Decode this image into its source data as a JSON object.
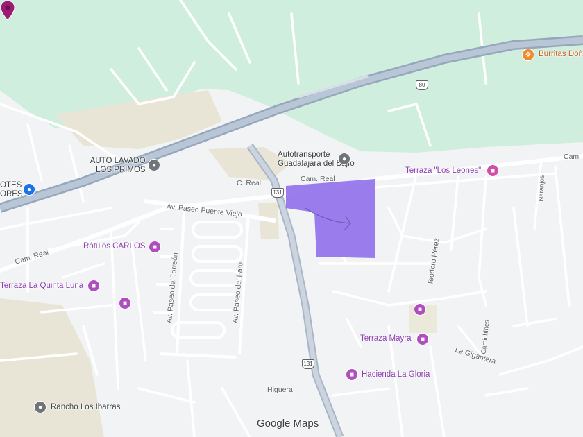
{
  "colors": {
    "park": "#cfeedd",
    "land": "#f1f3f4",
    "urban": "#e8e6dc",
    "road": "#ffffff",
    "highway": "#aab8c9",
    "highlight": "#8e6bec",
    "poi_purple": "#b04ec0",
    "poi_gray": "#70757a",
    "poi_orange": "#f08a2d",
    "marker": "#9c1b75"
  },
  "labels": {
    "burritas": "Burritas Doñ",
    "highway_shield_80": "80",
    "autolavado_line1": "AUTO LAVADO",
    "autolavado_line2": "LOS PRIMOS",
    "autotransporte_line1": "Autotransporte",
    "autotransporte_line2": "Guadalajara del Bajío",
    "terraza_leones": "Terraza \"Los Leones\"",
    "cam_edge": "Cam",
    "otes_line1": "OTES",
    "otes_line2": "ORES",
    "c_real": "C. Real",
    "shield_131_top": "131",
    "cam_real_top": "Cam. Real",
    "paseo_puente_viejo": "Av. Paseo Puente Viejo",
    "rotulos": "Rótulos CARLOS",
    "cam_real_left": "Cam. Real",
    "terraza_quinta_luna": "Terraza La Quinta Luna",
    "paseo_torreon": "Av. Paseo del Torreón",
    "paseo_faro": "Av. Paseo del Faro",
    "teodoro_perez": "Teodoro Pérez",
    "naranjos": "Naranjos",
    "camichines": "Camichines",
    "terraza_mayra": "Terraza Mayra",
    "la_gigantera": "La Gigantera",
    "shield_131_bottom": "131",
    "hacienda_gloria": "Hacienda La Gloria",
    "higuera": "Higuera",
    "rancho_ibarras": "Rancho Los Ibarras"
  },
  "icons": {
    "restaurant": "fork-knife-icon",
    "car_wash": "car-wash-icon",
    "transport": "pin-icon",
    "event_venue": "event-venue-icon",
    "shopping": "cart-icon",
    "store": "store-icon",
    "location": "marker-icon"
  },
  "attribution": {
    "logo": "Google Maps"
  }
}
